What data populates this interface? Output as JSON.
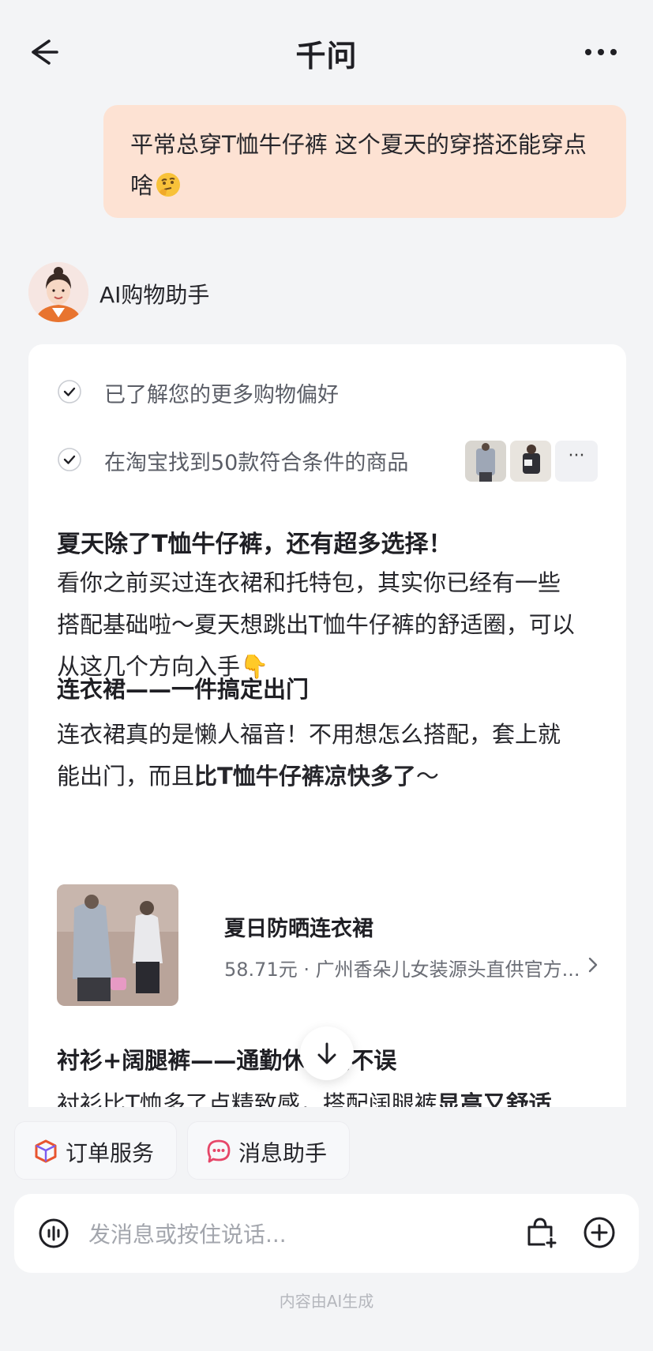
{
  "header": {
    "title": "千问"
  },
  "user_message": {
    "text": "平常总穿T恤牛仔裤  这个夏天的穿搭还能穿点啥",
    "emoji": "thinking-face-emoji"
  },
  "assistant": {
    "name": "AI购物助手"
  },
  "steps": [
    {
      "text": "已了解您的更多购物偏好"
    },
    {
      "text": "在淘宝找到50款符合条件的商品"
    }
  ],
  "steps_more_label": "···",
  "answer": {
    "heading": "夏天除了T恤牛仔裤，还有超多选择！",
    "intro": "看你之前买过连衣裙和托特包，其实你已经有一些搭配基础啦～夏天想跳出T恤牛仔裤的舒适圈，可以从这几个方向入手👇",
    "section1_title": "连衣裙——一件搞定出门",
    "section1_text_a": "连衣裙真的是懒人福音！不用想怎么搭配，套上就能出门，而且",
    "section1_text_b": "比T恤牛仔裤凉快多了",
    "section1_text_c": "～",
    "product": {
      "name": "夏日防晒连衣裙",
      "price": "58.71元",
      "separator": " · ",
      "shop": "广州香朵儿女装源头直供官方..."
    },
    "section2_title": "衬衫+阔腿裤——通勤休闲两不误",
    "section2_text_a": "衬衫比T恤多了点精致感，搭配阔腿裤",
    "section2_text_b": "显高又舒适"
  },
  "quick_actions": [
    {
      "label": "订单服务",
      "icon": "box-icon",
      "color": "#e8542f"
    },
    {
      "label": "消息助手",
      "icon": "chat-bubble-icon",
      "color": "#e64668"
    }
  ],
  "input": {
    "placeholder": "发消息或按住说话..."
  },
  "footer": {
    "note": "内容由AI生成"
  },
  "colors": {
    "user_bubble": "#fde2d3",
    "background": "#f3f4f6",
    "card": "#ffffff"
  }
}
